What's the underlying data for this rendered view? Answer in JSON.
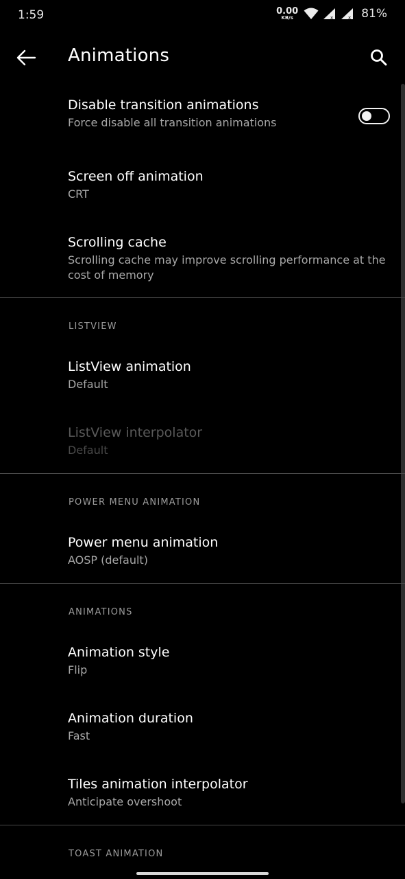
{
  "status_bar": {
    "time": "1:59",
    "net_speed_value": "0.00",
    "net_speed_unit": "KB/s",
    "battery": "81%"
  },
  "app_bar": {
    "title": "Animations"
  },
  "prefs": {
    "disable_transitions": {
      "title": "Disable transition animations",
      "summary": "Force disable all transition animations",
      "enabled": false
    },
    "screen_off": {
      "title": "Screen off animation",
      "summary": "CRT"
    },
    "scrolling_cache": {
      "title": "Scrolling cache",
      "summary": "Scrolling cache may improve scrolling performance at the cost of memory"
    },
    "listview_animation": {
      "title": "ListView animation",
      "summary": "Default"
    },
    "listview_interpolator": {
      "title": "ListView interpolator",
      "summary": "Default"
    },
    "power_menu_animation": {
      "title": "Power menu animation",
      "summary": "AOSP (default)"
    },
    "animation_style": {
      "title": "Animation style",
      "summary": "Flip"
    },
    "animation_duration": {
      "title": "Animation duration",
      "summary": "Fast"
    },
    "tiles_interpolator": {
      "title": "Tiles animation interpolator",
      "summary": "Anticipate overshoot"
    }
  },
  "categories": {
    "listview": "LISTVIEW",
    "power_menu": "POWER MENU ANIMATION",
    "animations": "ANIMATIONS",
    "toast": "TOAST ANIMATION"
  },
  "colors": {
    "background": "#000000",
    "text_primary": "#ffffff",
    "text_secondary": "#a8a8a8",
    "category": "#9c9c9c"
  }
}
